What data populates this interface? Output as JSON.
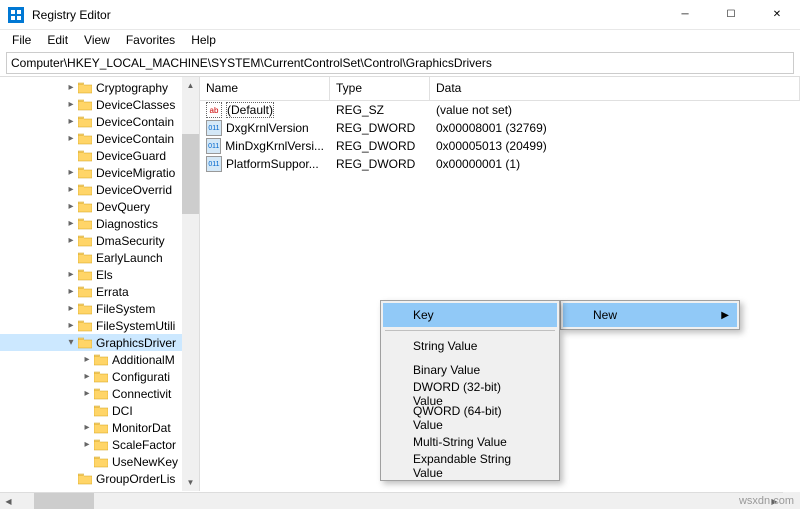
{
  "window": {
    "title": "Registry Editor"
  },
  "menubar": {
    "file": "File",
    "edit": "Edit",
    "view": "View",
    "favorites": "Favorites",
    "help": "Help"
  },
  "address": {
    "path": "Computer\\HKEY_LOCAL_MACHINE\\SYSTEM\\CurrentControlSet\\Control\\GraphicsDrivers"
  },
  "tree": {
    "items": [
      {
        "label": "Cryptography",
        "depth": 4,
        "exp": "▸"
      },
      {
        "label": "DeviceClasses",
        "depth": 4,
        "exp": "▸"
      },
      {
        "label": "DeviceContain",
        "depth": 4,
        "exp": "▸"
      },
      {
        "label": "DeviceContain",
        "depth": 4,
        "exp": "▸"
      },
      {
        "label": "DeviceGuard",
        "depth": 4,
        "exp": ""
      },
      {
        "label": "DeviceMigratio",
        "depth": 4,
        "exp": "▸"
      },
      {
        "label": "DeviceOverrid",
        "depth": 4,
        "exp": "▸"
      },
      {
        "label": "DevQuery",
        "depth": 4,
        "exp": "▸"
      },
      {
        "label": "Diagnostics",
        "depth": 4,
        "exp": "▸"
      },
      {
        "label": "DmaSecurity",
        "depth": 4,
        "exp": "▸"
      },
      {
        "label": "EarlyLaunch",
        "depth": 4,
        "exp": ""
      },
      {
        "label": "Els",
        "depth": 4,
        "exp": "▸"
      },
      {
        "label": "Errata",
        "depth": 4,
        "exp": "▸"
      },
      {
        "label": "FileSystem",
        "depth": 4,
        "exp": "▸"
      },
      {
        "label": "FileSystemUtili",
        "depth": 4,
        "exp": "▸"
      },
      {
        "label": "GraphicsDriver",
        "depth": 4,
        "exp": "▾",
        "selected": true
      },
      {
        "label": "AdditionalM",
        "depth": 5,
        "exp": "▸"
      },
      {
        "label": "Configurati",
        "depth": 5,
        "exp": "▸"
      },
      {
        "label": "Connectivit",
        "depth": 5,
        "exp": "▸"
      },
      {
        "label": "DCI",
        "depth": 5,
        "exp": ""
      },
      {
        "label": "MonitorDat",
        "depth": 5,
        "exp": "▸"
      },
      {
        "label": "ScaleFactor",
        "depth": 5,
        "exp": "▸"
      },
      {
        "label": "UseNewKey",
        "depth": 5,
        "exp": ""
      },
      {
        "label": "GroupOrderLis",
        "depth": 4,
        "exp": ""
      }
    ]
  },
  "list": {
    "headers": {
      "name": "Name",
      "type": "Type",
      "data": "Data"
    },
    "rows": [
      {
        "icon": "sz",
        "name": "(Default)",
        "type": "REG_SZ",
        "data": "(value not set)",
        "selected": true
      },
      {
        "icon": "bin",
        "name": "DxgKrnlVersion",
        "type": "REG_DWORD",
        "data": "0x00008001 (32769)"
      },
      {
        "icon": "bin",
        "name": "MinDxgKrnlVersi...",
        "type": "REG_DWORD",
        "data": "0x00005013 (20499)"
      },
      {
        "icon": "bin",
        "name": "PlatformSuppor...",
        "type": "REG_DWORD",
        "data": "0x00000001 (1)"
      }
    ]
  },
  "context_parent": {
    "items": [
      {
        "label": "New",
        "highlighted": true,
        "submenu": true
      }
    ]
  },
  "context_sub": {
    "items": [
      {
        "label": "Key",
        "highlighted": true
      },
      {
        "label": "String Value"
      },
      {
        "label": "Binary Value"
      },
      {
        "label": "DWORD (32-bit) Value"
      },
      {
        "label": "QWORD (64-bit) Value"
      },
      {
        "label": "Multi-String Value"
      },
      {
        "label": "Expandable String Value"
      }
    ]
  },
  "watermark": "wsxdn.com"
}
